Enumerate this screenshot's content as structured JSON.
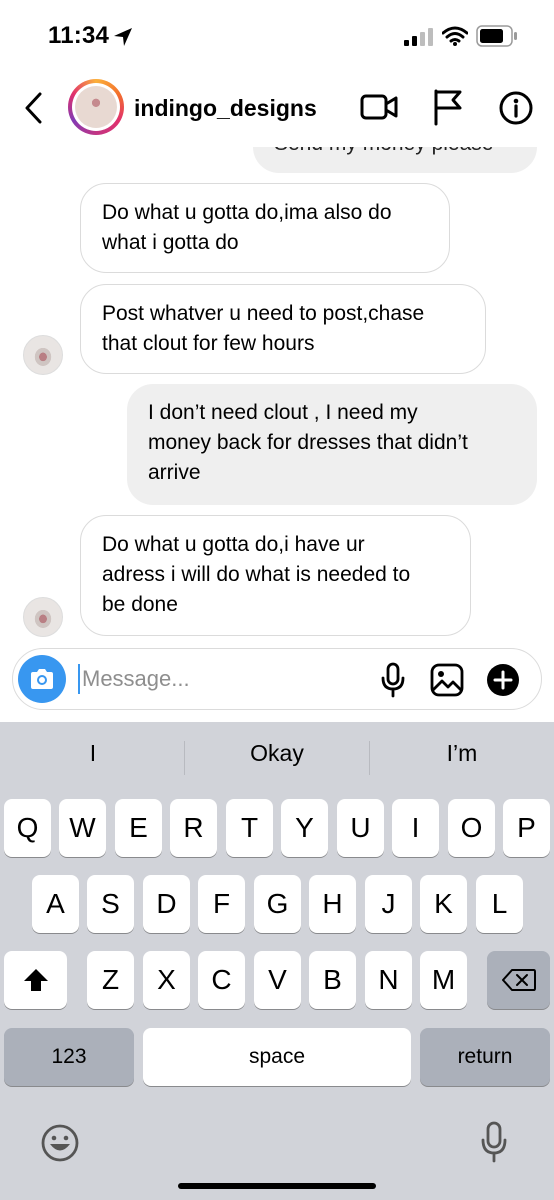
{
  "status_bar": {
    "time": "11:34"
  },
  "header": {
    "username": "indingo_designs"
  },
  "messages": [
    {
      "side": "sent",
      "lines": [
        "Send my money please"
      ]
    },
    {
      "side": "received",
      "lines": [
        "Do what u gotta do,ima also do",
        "what i gotta do"
      ]
    },
    {
      "side": "received",
      "lines": [
        "Post whatver u need to post,chase",
        "that clout for few hours"
      ]
    },
    {
      "side": "sent",
      "lines": [
        "I don’t need clout , I need my",
        "money back for dresses that didn’t",
        "arrive"
      ]
    },
    {
      "side": "received",
      "lines": [
        "Do what u gotta do,i have ur",
        "adress i will do what is needed to",
        "be done"
      ]
    }
  ],
  "composer": {
    "placeholder": "Message..."
  },
  "keyboard": {
    "suggestions": [
      "I",
      "Okay",
      "I’m"
    ],
    "row1": [
      "Q",
      "W",
      "E",
      "R",
      "T",
      "Y",
      "U",
      "I",
      "O",
      "P"
    ],
    "row2": [
      "A",
      "S",
      "D",
      "F",
      "G",
      "H",
      "J",
      "K",
      "L"
    ],
    "row3": [
      "Z",
      "X",
      "C",
      "V",
      "B",
      "N",
      "M"
    ],
    "numbers_label": "123",
    "space_label": "space",
    "return_label": "return"
  },
  "colors": {
    "accent": "#3897f0",
    "sent_bubble": "#efefef",
    "keyboard_bg": "#d1d3d9"
  }
}
